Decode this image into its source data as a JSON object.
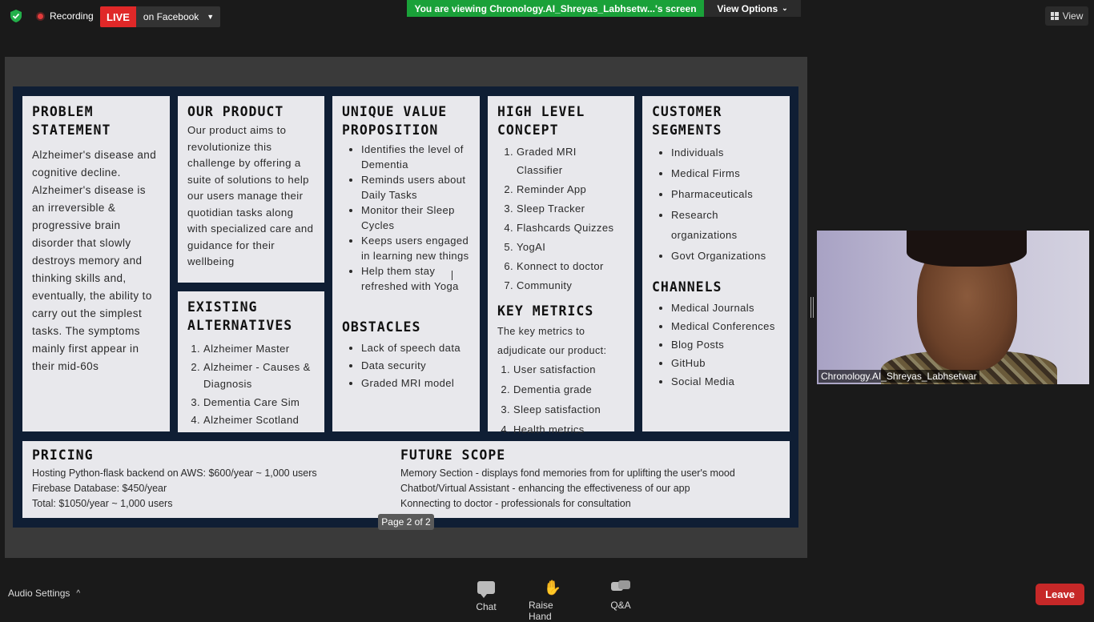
{
  "topbar": {
    "recording_label": "Recording",
    "live_badge": "LIVE",
    "live_target": "on Facebook",
    "viewing_banner": "You are viewing Chronology.AI_Shreyas_Labhsetw...'s screen",
    "view_options": "View Options",
    "view_button": "View"
  },
  "slide": {
    "problem": {
      "title": "PROBLEM STATEMENT",
      "text": "Alzheimer's disease and cognitive decline. Alzheimer's  disease is an irreversible  & progressive brain disorder that slowly destroys memory and thinking skills and, eventually, the ability to carry out the simplest tasks. The symptoms mainly first appear in their mid-60s"
    },
    "product": {
      "title": "OUR PRODUCT",
      "text": "Our product aims to revolutionize this challenge  by offering a suite of solutions  to help our users manage their quotidian tasks along with specialized care and guidance for their wellbeing"
    },
    "existing": {
      "title": "EXISTING ALTERNATIVES",
      "items": [
        "Alzheimer Master",
        "Alzheimer - Causes & Diagnosis",
        "Dementia Care Sim",
        "Alzheimer Scotland"
      ]
    },
    "uvp": {
      "title": "UNIQUE VALUE PROPOSITION",
      "items": [
        "Identifies the level of Dementia",
        "Reminds users about Daily Tasks",
        "Monitor their Sleep Cycles",
        "Keeps users engaged in learning new things",
        "Help them stay refreshed with Yoga"
      ]
    },
    "obstacles": {
      "title": "OBSTACLES",
      "items": [
        "Lack of speech data",
        "Data security",
        "Graded MRI model"
      ]
    },
    "hlc": {
      "title": "HIGH LEVEL CONCEPT",
      "items": [
        "Graded MRI Classifier",
        "Reminder App",
        "Sleep Tracker",
        "Flashcards Quizzes",
        "YogAI",
        "Konnect to doctor",
        "Community"
      ]
    },
    "metrics": {
      "title": "KEY METRICS",
      "intro": "The key metrics to adjudicate our product:",
      "items": [
        "User satisfaction",
        "Dementia grade",
        "Sleep satisfaction",
        "Health metrics"
      ]
    },
    "customers": {
      "title": "CUSTOMER SEGMENTS",
      "items": [
        "Individuals",
        "Medical Firms",
        "Pharmaceuticals",
        "Research organizations",
        "Govt Organizations"
      ]
    },
    "channels": {
      "title": "CHANNELS",
      "items": [
        "Medical Journals",
        "Medical Conferences",
        "Blog Posts",
        "GitHub",
        "Social Media"
      ]
    },
    "pricing": {
      "title": "PRICING",
      "lines": [
        "Hosting Python-flask backend on AWS: $600/year ~ 1,000 users",
        "Firebase Database: $450/year",
        "Total: $1050/year ~ 1,000 users"
      ]
    },
    "future": {
      "title": "FUTURE SCOPE",
      "lines": [
        "Memory Section - displays fond memories from for uplifting the user's mood",
        "Chatbot/Virtual Assistant - enhancing the effectiveness of our app",
        "Konnecting to doctor - professionals for consultation"
      ]
    }
  },
  "page_indicator": "Page 2 of 2",
  "video": {
    "participant_name": "Chronology.AI_Shreyas_Labhsetwar"
  },
  "bottombar": {
    "audio_settings": "Audio Settings",
    "chat": "Chat",
    "raise_hand": "Raise Hand",
    "qa": "Q&A",
    "leave": "Leave"
  },
  "colors": {
    "live": "#e02828",
    "viewing_banner": "#1aa139",
    "leave": "#c62828",
    "slide_background": "#0f1e34"
  },
  "icons": {
    "security": "shield-check-icon",
    "recording": "record-dot-icon",
    "chat": "chat-bubble-icon",
    "raise_hand": "hand-icon",
    "qa": "qa-bubbles-icon",
    "view": "grid-icon"
  }
}
